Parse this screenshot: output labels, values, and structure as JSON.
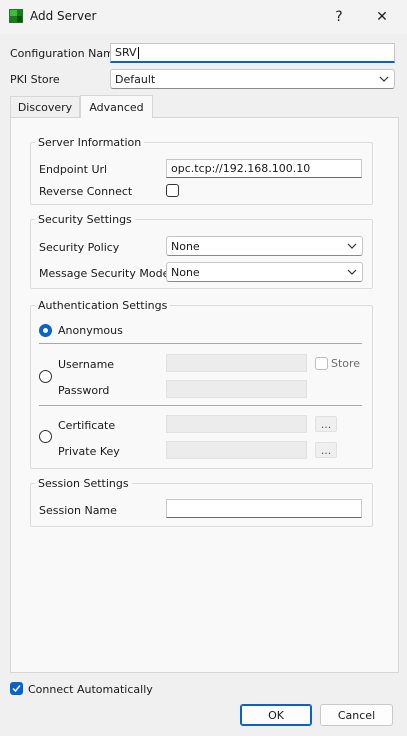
{
  "window": {
    "title": "Add Server",
    "help_glyph": "?",
    "close_glyph": "✕"
  },
  "form": {
    "config_name_label": "Configuration Name",
    "config_name_value": "SRV",
    "pki_label": "PKI Store",
    "pki_value": "Default"
  },
  "tabs": [
    {
      "label": "Discovery"
    },
    {
      "label": "Advanced"
    }
  ],
  "server_info": {
    "title": "Server Information",
    "endpoint_label": "Endpoint Url",
    "endpoint_value": "opc.tcp://192.168.100.10",
    "reverse_label": "Reverse Connect"
  },
  "security": {
    "title": "Security Settings",
    "policy_label": "Security Policy",
    "policy_value": "None",
    "mode_label": "Message Security Mode",
    "mode_value": "None"
  },
  "auth": {
    "title": "Authentication Settings",
    "anonymous_label": "Anonymous",
    "username_label": "Username",
    "store_label": "Store",
    "password_label": "Password",
    "certificate_label": "Certificate",
    "private_key_label": "Private Key",
    "ellipsis": "..."
  },
  "session": {
    "title": "Session Settings",
    "name_label": "Session Name",
    "name_value": ""
  },
  "footer": {
    "auto_connect_label": "Connect Automatically",
    "ok_label": "OK",
    "cancel_label": "Cancel"
  },
  "colors": {
    "accent": "#0a62c6",
    "panel": "#f9f9f9",
    "window": "#f0f0f0"
  }
}
